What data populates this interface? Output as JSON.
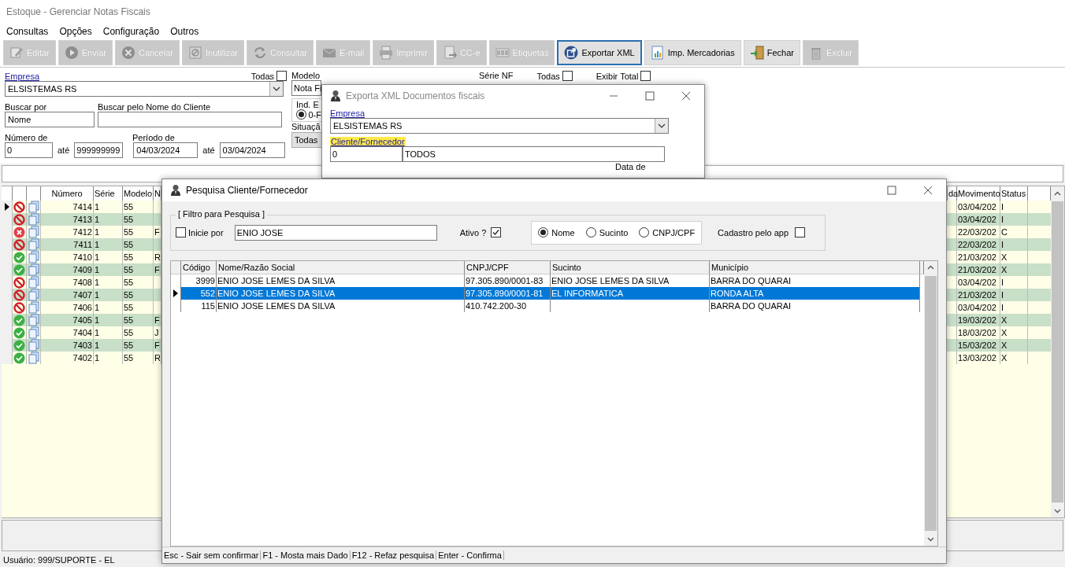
{
  "window": {
    "title": "Estoque - Gerenciar Notas Fiscais"
  },
  "menu": [
    "Consultas",
    "Opções",
    "Configuração",
    "Outros"
  ],
  "toolbar": [
    {
      "label": "Editar",
      "disabled": true,
      "focused": false
    },
    {
      "label": "Enviar",
      "disabled": true,
      "focused": false
    },
    {
      "label": "Cancelar",
      "disabled": true,
      "focused": false
    },
    {
      "label": "Inutilizar",
      "disabled": true,
      "focused": false
    },
    {
      "label": "Consultar",
      "disabled": true,
      "focused": false
    },
    {
      "label": "E-mail",
      "disabled": true,
      "focused": false
    },
    {
      "label": "Imprimir",
      "disabled": true,
      "focused": false
    },
    {
      "label": "CC-e",
      "disabled": true,
      "focused": false
    },
    {
      "label": "Etiquetas",
      "disabled": true,
      "focused": false
    },
    {
      "label": "Exportar XML",
      "disabled": false,
      "focused": true
    },
    {
      "label": "Imp. Mercadorias",
      "disabled": false,
      "focused": false
    },
    {
      "label": "Fechar",
      "disabled": false,
      "focused": false
    },
    {
      "label": "Excluir",
      "disabled": true,
      "focused": false
    }
  ],
  "filters": {
    "empresa_label": "Empresa",
    "todas_label": "Todas",
    "todas_checked": false,
    "empresa": "ELSISTEMAS RS",
    "buscar_por_label": "Buscar por",
    "buscar_por": "Nome",
    "buscar_nome_label": "Buscar pelo Nome do Cliente",
    "numero_label": "Número de",
    "numero_de": "0",
    "numero_ate_label": "até",
    "numero_ate": "999999999",
    "periodo_label": "Período de",
    "periodo_de": "04/03/2024",
    "periodo_ate_label": "até",
    "periodo_ate": "03/04/2024",
    "modelo_label": "Modelo",
    "modelo": "Nota Fi",
    "ind_label": "Ind. E",
    "ind_option": "0-F",
    "ind_selected": true,
    "situacao_label": "Situaçã",
    "situacao": "Todas",
    "serie_label": "Série NF",
    "todas2_label": "Todas",
    "todas2_checked": false,
    "exibir_label": "Exibir Total",
    "exibir_checked": false
  },
  "grid": {
    "columns": [
      "Número",
      "Série",
      "Modelo",
      "N",
      "da",
      "Movimento",
      "Status"
    ],
    "rows": [
      {
        "kind": "blocked",
        "numero": "7414",
        "serie": "1",
        "modelo": "55",
        "movimento": "03/04/202",
        "status": "I",
        "selected": true
      },
      {
        "kind": "blocked",
        "numero": "7413",
        "serie": "1",
        "modelo": "55",
        "movimento": "03/04/202",
        "status": "I",
        "selected": false
      },
      {
        "kind": "error",
        "numero": "7412",
        "serie": "1",
        "modelo": "55",
        "column_4": "F",
        "movimento": "22/03/202",
        "status": "C",
        "selected": false
      },
      {
        "kind": "blocked",
        "numero": "7411",
        "serie": "1",
        "modelo": "55",
        "movimento": "22/03/202",
        "status": "I",
        "selected": false
      },
      {
        "kind": "ok",
        "numero": "7410",
        "serie": "1",
        "modelo": "55",
        "column_4": "R",
        "movimento": "21/03/202",
        "status": "X",
        "selected": false
      },
      {
        "kind": "ok",
        "numero": "7409",
        "serie": "1",
        "modelo": "55",
        "column_4": "F",
        "movimento": "21/03/202",
        "status": "X",
        "selected": false
      },
      {
        "kind": "blocked",
        "numero": "7408",
        "serie": "1",
        "modelo": "55",
        "movimento": "03/04/202",
        "status": "I",
        "selected": false
      },
      {
        "kind": "blocked",
        "numero": "7407",
        "serie": "1",
        "modelo": "55",
        "movimento": "21/03/202",
        "status": "I",
        "selected": false
      },
      {
        "kind": "blocked",
        "numero": "7406",
        "serie": "1",
        "modelo": "55",
        "movimento": "03/04/202",
        "status": "I",
        "selected": false
      },
      {
        "kind": "ok",
        "numero": "7405",
        "serie": "1",
        "modelo": "55",
        "column_4": "F",
        "movimento": "19/03/202",
        "status": "X",
        "selected": false
      },
      {
        "kind": "ok",
        "numero": "7404",
        "serie": "1",
        "modelo": "55",
        "column_4": "J",
        "movimento": "18/03/202",
        "status": "X",
        "selected": false
      },
      {
        "kind": "ok",
        "numero": "7403",
        "serie": "1",
        "modelo": "55",
        "column_4": "F",
        "movimento": "15/03/202",
        "status": "X",
        "selected": false
      },
      {
        "kind": "ok",
        "numero": "7402",
        "serie": "1",
        "modelo": "55",
        "column_4": "R",
        "movimento": "13/03/202",
        "status": "X",
        "selected": false
      }
    ]
  },
  "status_bar": "Usuário: 999/SUPORTE - EL",
  "export_dialog": {
    "title": "Exporta XML Documentos fiscais",
    "empresa_label": "Empresa",
    "empresa": "ELSISTEMAS RS",
    "cliente_label": "Cliente/Fornecedor",
    "cliente_codigo": "0",
    "cliente_nome": "TODOS",
    "data_label": "Data de"
  },
  "search_dialog": {
    "title": "Pesquisa Cliente/Fornecedor",
    "group_label": "[ Filtro para Pesquisa ]",
    "inicie_label": "Inicie por",
    "inicie_checked": false,
    "search_value": "ENIO JOSE",
    "ativo_label": "Ativo ?",
    "ativo_checked": true,
    "options": [
      {
        "label": "Nome",
        "selected": true
      },
      {
        "label": "Sucinto",
        "selected": false
      },
      {
        "label": "CNPJ/CPF",
        "selected": false
      }
    ],
    "app_label": "Cadastro pelo app",
    "app_checked": false,
    "columns": [
      "Código",
      "Nome/Razão Social",
      "CNPJ/CPF",
      "Sucinto",
      "Município"
    ],
    "rows": [
      {
        "cells": [
          "3999",
          "ENIO JOSE LEMES DA SILVA",
          "97.305.890/0001-83",
          "ENIO JOSE LEMES DA SILVA",
          "BARRA DO QUARAI"
        ],
        "selected": false
      },
      {
        "cells": [
          "552",
          "ENIO JOSE LEMES DA SILVA",
          "97.305.890/0001-81",
          "EL INFORMATICA",
          "RONDA ALTA"
        ],
        "selected": true
      },
      {
        "cells": [
          "115",
          "ENIO JOSE LEMES DA SILVA",
          "410.742.200-30",
          "",
          "BARRA DO QUARAI"
        ],
        "selected": false
      }
    ],
    "shortcuts": [
      "Esc - Sair sem confirmar",
      "F1 - Mosta mais Dado",
      "F12 - Refaz pesquisa",
      "Enter - Confirma"
    ]
  }
}
